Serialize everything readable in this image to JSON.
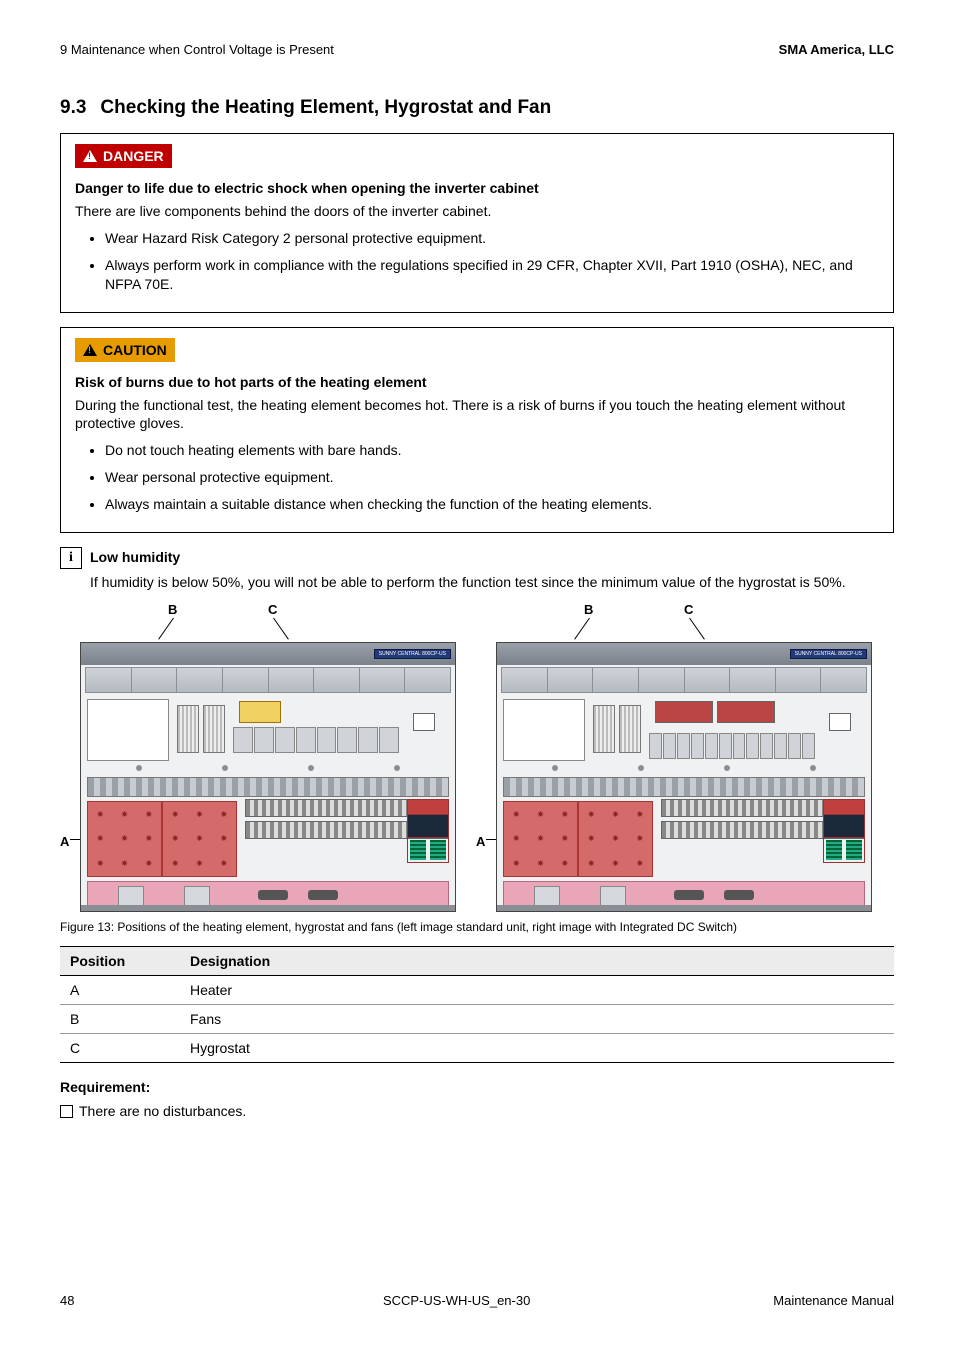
{
  "header": {
    "left": "9  Maintenance when Control Voltage is Present",
    "right": "SMA America, LLC"
  },
  "section": {
    "number": "9.3",
    "title": "Checking the Heating Element, Hygrostat and Fan"
  },
  "danger": {
    "label": "DANGER",
    "heading": "Danger to life due to electric shock when opening the inverter cabinet",
    "body": "There are live components behind the doors of the inverter cabinet.",
    "bullets": [
      "Wear Hazard Risk Category 2 personal protective equipment.",
      "Always perform work in compliance with the regulations specified in 29 CFR, Chapter XVII, Part 1910 (OSHA), NEC, and NFPA 70E."
    ]
  },
  "caution": {
    "label": "CAUTION",
    "heading": "Risk of burns due to hot parts of the heating element",
    "body": "During the functional test, the heating element becomes hot. There is a risk of burns if you touch the heating element without protective gloves.",
    "bullets": [
      "Do not touch heating elements with bare hands.",
      "Wear personal protective equipment.",
      "Always maintain a suitable distance when checking the function of the heating elements."
    ]
  },
  "info": {
    "heading": "Low humidity",
    "body": "If humidity is below 50%, you will not be able to perform the function test since the minimum value of the hygrostat is 50%."
  },
  "figure": {
    "labels": {
      "a": "A",
      "b": "B",
      "c": "C"
    },
    "plate": "SUNNY CENTRAL 800CP-US",
    "caption": "Figure 13:  Positions of the heating element, hygrostat and fans (left image standard unit, right image with Integrated DC Switch)"
  },
  "table": {
    "headers": [
      "Position",
      "Designation"
    ],
    "rows": [
      [
        "A",
        "Heater"
      ],
      [
        "B",
        "Fans"
      ],
      [
        "C",
        "Hygrostat"
      ]
    ]
  },
  "requirement": {
    "heading": "Requirement:",
    "items": [
      "There are no disturbances."
    ]
  },
  "footer": {
    "page": "48",
    "doc": "SCCP-US-WH-US_en-30",
    "title": "Maintenance Manual"
  }
}
